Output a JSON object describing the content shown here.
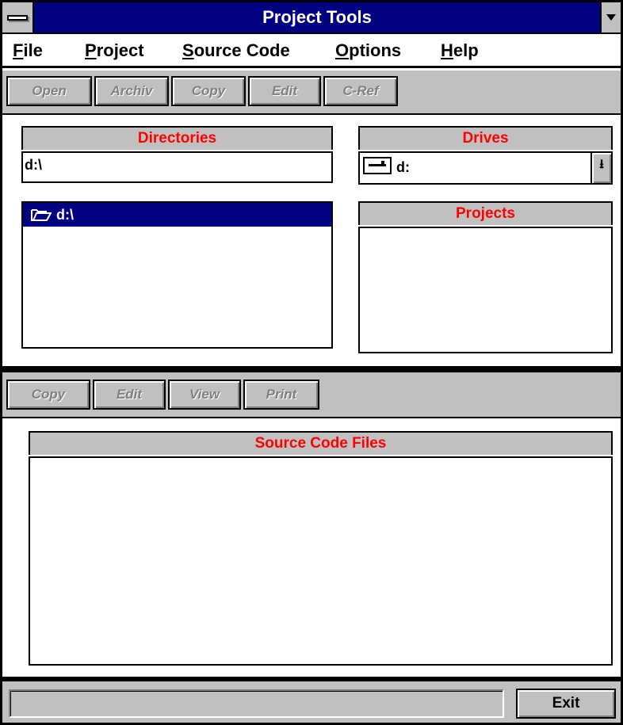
{
  "window": {
    "title": "Project Tools"
  },
  "menu": [
    {
      "u": "F",
      "rest": "ile"
    },
    {
      "u": "P",
      "rest": "roject"
    },
    {
      "u": "S",
      "rest": "ource Code"
    },
    {
      "u": "O",
      "rest": "ptions"
    },
    {
      "u": "H",
      "rest": "elp"
    }
  ],
  "project_toolbar": {
    "buttons": [
      "Open",
      "Archiv",
      "Copy",
      "Edit",
      "C-Ref"
    ],
    "enabled": false
  },
  "directories": {
    "header": "Directories",
    "path": "d:\\",
    "items": [
      {
        "label": "d:\\",
        "icon": "open-folder-icon",
        "selected": true
      }
    ]
  },
  "drives": {
    "header": "Drives",
    "selected": "d:",
    "icon": "drive-icon"
  },
  "projects": {
    "header": "Projects",
    "items": []
  },
  "source_toolbar": {
    "buttons": [
      "Copy",
      "Edit",
      "View",
      "Print"
    ],
    "enabled": false
  },
  "source_files": {
    "header": "Source Code Files",
    "items": []
  },
  "status": {
    "text": ""
  },
  "exit_button": {
    "label": "Exit"
  },
  "colors": {
    "titlebar": "#000080",
    "face": "#c0c0c0",
    "header_text": "#ff0000",
    "selection": "#000080"
  }
}
